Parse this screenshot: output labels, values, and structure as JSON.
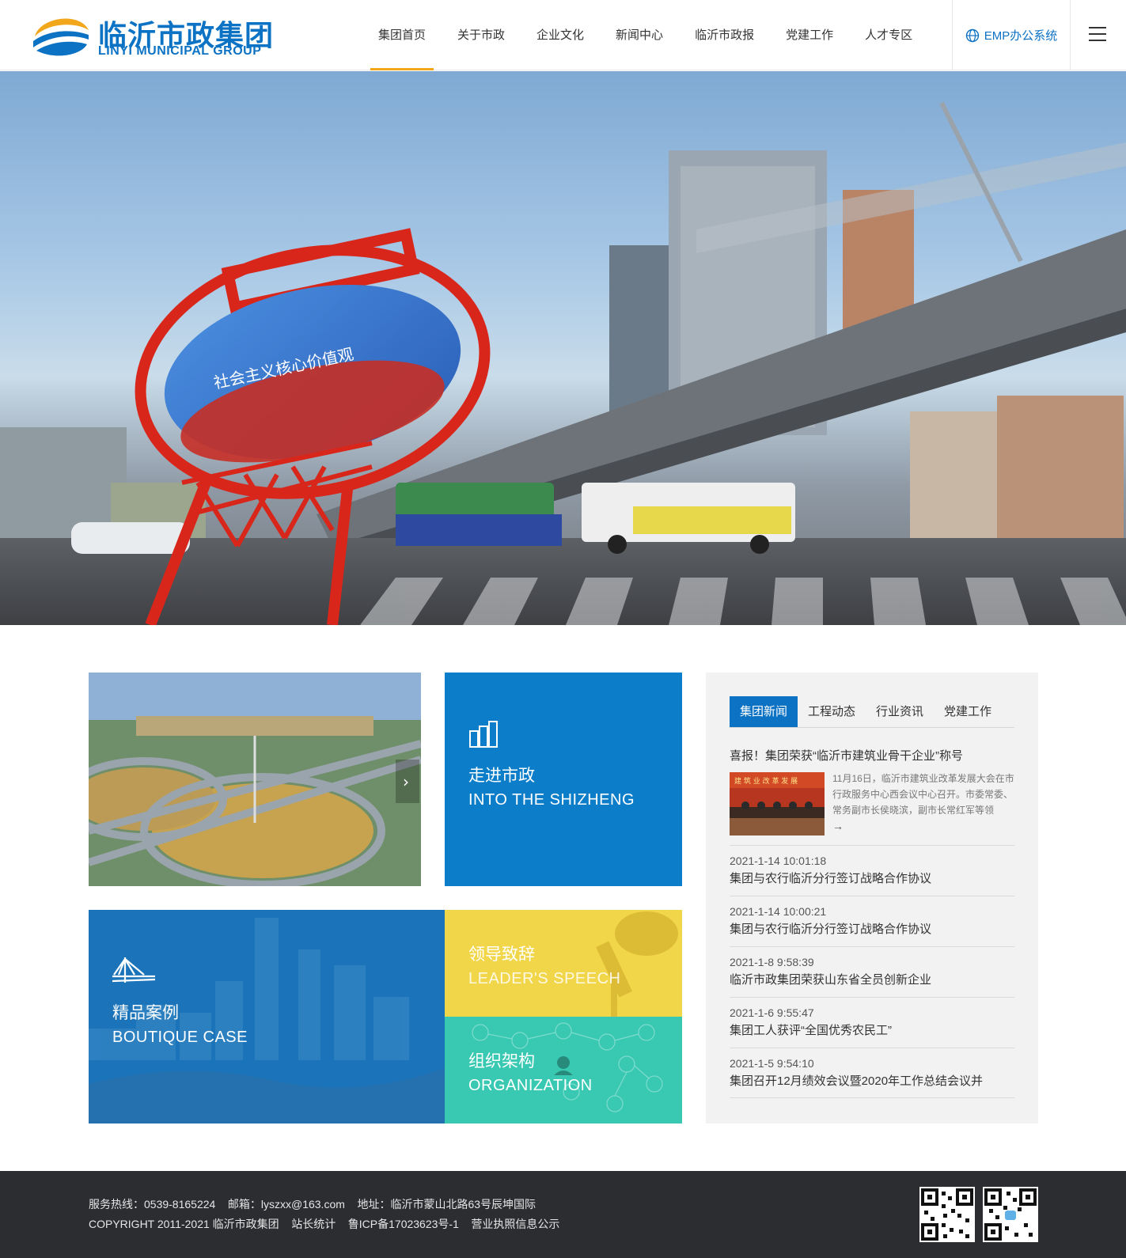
{
  "brand": {
    "name_cn": "临沂市政集团",
    "name_en": "LINYI MUNICIPAL GROUP",
    "primary_color": "#0c72c4",
    "accent_color": "#f2a71b"
  },
  "nav": {
    "items": [
      {
        "label": "集团首页",
        "active": true
      },
      {
        "label": "关于市政"
      },
      {
        "label": "企业文化"
      },
      {
        "label": "新闻中心"
      },
      {
        "label": "临沂市政报"
      },
      {
        "label": "党建工作"
      },
      {
        "label": "人才专区"
      }
    ],
    "emp_label": "EMP办公系统",
    "emp_icon": "globe-icon",
    "menu_icon": "hamburger-icon"
  },
  "banner": {
    "description_icon": "city-overpass-photo",
    "sign_text": "社会主义核心价值观"
  },
  "tiles": {
    "into": {
      "title": "走进市政",
      "subtitle": "INTO THE SHIZHENG",
      "icon": "buildings-icon",
      "color": "#0c7ec9"
    },
    "boutique": {
      "title": "精品案例",
      "subtitle": "BOUTIQUE CASE",
      "icon": "bridge-icon",
      "color": "#1b74b9"
    },
    "leader": {
      "title": "领导致辞",
      "subtitle": "LEADER'S SPEECH",
      "color": "#f2d649"
    },
    "org": {
      "title": "组织架构",
      "subtitle": "ORGANIZATION",
      "color": "#39c9b3"
    }
  },
  "news": {
    "tabs": [
      {
        "label": "集团新闻",
        "active": true
      },
      {
        "label": "工程动态"
      },
      {
        "label": "行业资讯"
      },
      {
        "label": "党建工作"
      }
    ],
    "headline": "喜报！集团荣获“临沂市建筑业骨干企业”称号",
    "thumb_banner": "建 筑 业 改 革 发 展",
    "excerpt": "11月16日，临沂市建筑业改革发展大会在市行政服务中心西会议中心召开。市委常委、常务副市长侯晓滨，副市长常红军等领",
    "arrow": "→",
    "items": [
      {
        "date": "2021-1-14 10:01:18",
        "title": "集团与农行临沂分行签订战略合作协议"
      },
      {
        "date": "2021-1-14 10:00:21",
        "title": "集团与农行临沂分行签订战略合作协议"
      },
      {
        "date": "2021-1-8 9:58:39",
        "title": "临沂市政集团荣获山东省全员创新企业"
      },
      {
        "date": "2021-1-6 9:55:47",
        "title": "集团工人获评“全国优秀农民工”"
      },
      {
        "date": "2021-1-5 9:54:10",
        "title": "集团召开12月绩效会议暨2020年工作总结会议并"
      }
    ]
  },
  "footer": {
    "line1": "服务热线：0539-8165224    邮箱：lyszxx@163.com    地址：临沂市蒙山北路63号辰坤国际",
    "line2": "COPYRIGHT 2011-2021 临沂市政集团    站长统计    鲁ICP备17023623号-1    营业执照信息公示",
    "bg_color": "#2b2d31"
  }
}
